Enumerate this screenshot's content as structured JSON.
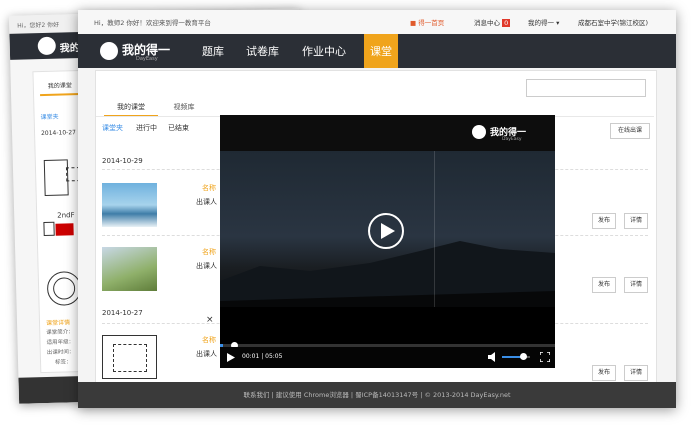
{
  "back": {
    "topbar_text": "Hi，您好2 你好",
    "tab_active": "我的课堂",
    "filter_label": "课堂夹",
    "date": "2014-10-27",
    "detail_link": "课堂详情",
    "detail_lines": [
      "课堂简介：",
      "适用年级：",
      "出课时间：",
      "标签："
    ],
    "math_text": "2ndF"
  },
  "front": {
    "topbar": {
      "greeting": "Hi，教师2 你好！欢迎来到得一教育平台",
      "home_link": "得一首页",
      "message_center": "消息中心",
      "message_count": "0",
      "my_deyi": "我的得一",
      "school": "成都石室中学(锦江校区)"
    },
    "navbar": {
      "logo_text": "我的得一",
      "logo_sub": "DayEasy",
      "items": [
        "题库",
        "试卷库",
        "作业中心",
        "课堂"
      ]
    },
    "tabs": [
      "我的课堂",
      "视频库"
    ],
    "filters": [
      "课堂夹",
      "进行中",
      "已结束"
    ],
    "online_button": "在线出课",
    "dates": [
      "2014-10-29",
      "2014-10-27"
    ],
    "course_fields": {
      "name": "名称",
      "author": "出课人"
    },
    "actions": {
      "publish": "发布",
      "detail": "详情"
    },
    "close_symbol": "×",
    "footer": "联系我们 | 建议使用 Chrome浏览器 | 蜀ICP备14013147号 | © 2013-2014 DayEasy.net"
  },
  "video": {
    "logo_text": "我的得一",
    "logo_sub": "DayEasy",
    "time": "00:01 | 05:05",
    "progress": 0.01,
    "volume": 0.75
  }
}
